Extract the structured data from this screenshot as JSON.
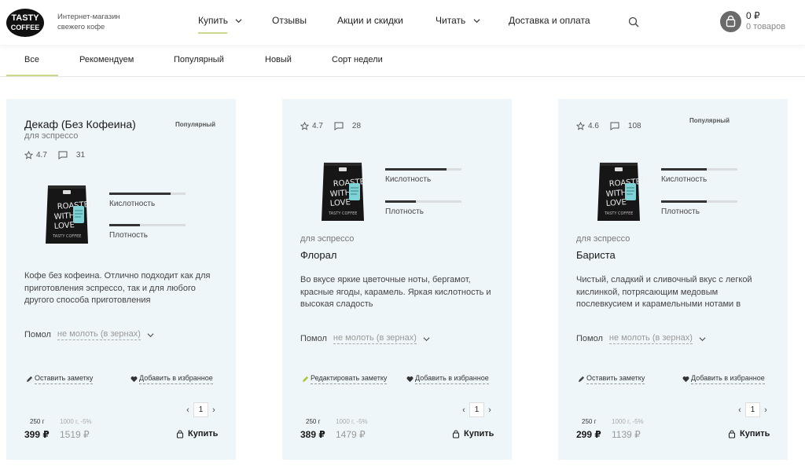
{
  "header": {
    "logo_text": "TASTY COFFEE",
    "tagline": "Интернет-магазин свежего кофе",
    "nav": [
      {
        "label": "Купить"
      },
      {
        "label": "Отзывы"
      },
      {
        "label": "Акции и скидки"
      },
      {
        "label": "Читать"
      },
      {
        "label": "Доставка и оплата"
      }
    ],
    "cart_amount": "0 ₽",
    "cart_count": "0 товаров"
  },
  "tabs": [
    {
      "label": "Все"
    },
    {
      "label": "Рекомендуем"
    },
    {
      "label": "Популярный"
    },
    {
      "label": "Новый"
    },
    {
      "label": "Сорт недели"
    }
  ],
  "product_bag_text": "ROASTED WITH LOVE",
  "product_bag_brand": "TASTY COFFEE",
  "cards": [
    {
      "title": "Декаф (Без Кофеина)",
      "subtitle": "для эспрессо",
      "badge": "Популярный",
      "rating": "4.7",
      "reviews": "31",
      "acidity_label": "Кислотность",
      "acidity": 0.8,
      "density_label": "Плотность",
      "density": 0.4,
      "description": "Кофе без кофеина. Отлично подходит как для приготовления эспрессо, так и для любого другого способа приготовления",
      "grind_label": "Помол",
      "grind_value": "не молоть (в зернах)",
      "note_label": "Оставить заметку",
      "fav_label": "Добавить в избранное",
      "qty": "1",
      "weight_small": "250 г",
      "weight_big": "1000 г, -5%",
      "price": "399 ₽",
      "price_big": "1519 ₽",
      "buy_label": "Купить"
    },
    {
      "title": "Флорал",
      "subtitle": "для эспрессо",
      "badge": "",
      "rating": "4.7",
      "reviews": "28",
      "acidity_label": "Кислотность",
      "acidity": 0.8,
      "density_label": "Плотность",
      "density": 0.4,
      "description": "Во вкусе яркие цветочные ноты, бергамот, красные ягоды, карамель. Яркая кислотность и высокая сладость",
      "grind_label": "Помол",
      "grind_value": "не молоть (в зернах)",
      "note_label": "Редактировать заметку",
      "fav_label": "Добавить в избранное",
      "qty": "1",
      "weight_small": "250 г",
      "weight_big": "1000 г, -5%",
      "price": "389 ₽",
      "price_big": "1479 ₽",
      "buy_label": "Купить"
    },
    {
      "title": "Бариста",
      "subtitle": "для эспрессо",
      "badge": "Популярный",
      "rating": "4.6",
      "reviews": "108",
      "acidity_label": "Кислотность",
      "acidity": 0.6,
      "density_label": "Плотность",
      "density": 0.6,
      "description": "Чистый, сладкий и сливочный вкус с легкой кислинкой, потрясающим медовым послевкусием и карамельными нотами в",
      "grind_label": "Помол",
      "grind_value": "не молоть (в зернах)",
      "note_label": "Оставить заметку",
      "fav_label": "Добавить в избранное",
      "qty": "1",
      "weight_small": "250 г",
      "weight_big": "1000 г, -5%",
      "price": "299 ₽",
      "price_big": "1139 ₽",
      "buy_label": "Купить"
    }
  ]
}
